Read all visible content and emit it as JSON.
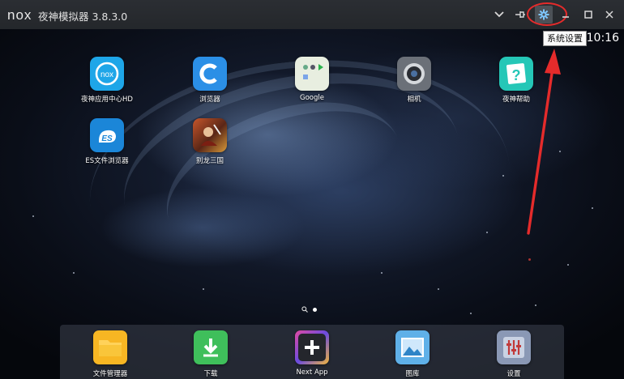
{
  "window": {
    "logo": "nox",
    "title": "夜神模拟器 3.8.3.0",
    "tooltip": "系统设置"
  },
  "status": {
    "time": "10:16"
  },
  "apps": [
    {
      "label": "夜神应用中心HD",
      "icon": "nox-appcenter-icon"
    },
    {
      "label": "浏览器",
      "icon": "browser-icon"
    },
    {
      "label": "Google",
      "icon": "google-folder-icon"
    },
    {
      "label": "相机",
      "icon": "camera-icon"
    },
    {
      "label": "夜神帮助",
      "icon": "help-icon"
    },
    {
      "label": "ES文件浏览器",
      "icon": "es-file-explorer-icon"
    },
    {
      "label": "别龙三国",
      "icon": "game-icon"
    }
  ],
  "dock": [
    {
      "label": "文件管理器",
      "icon": "folder-icon"
    },
    {
      "label": "下载",
      "icon": "download-icon"
    },
    {
      "label": "Next App",
      "icon": "plus-icon"
    },
    {
      "label": "图库",
      "icon": "gallery-icon"
    },
    {
      "label": "设置",
      "icon": "settings-icon"
    }
  ],
  "colors": {
    "annotation": "#e52b2b",
    "titlebar": "#2b2e33"
  }
}
